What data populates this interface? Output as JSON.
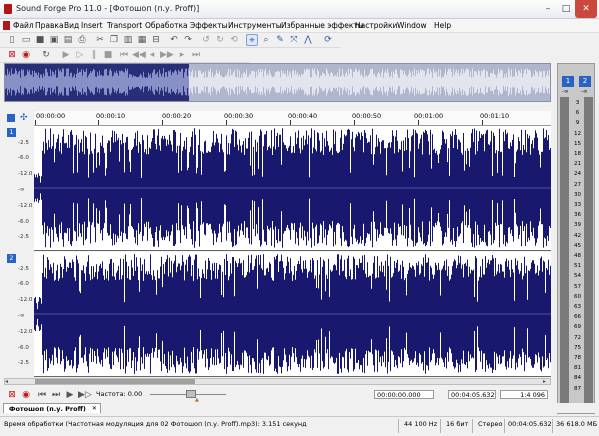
{
  "window": {
    "title": "Sound Forge Pro 11.0 - [Фотошоп (п.у. Proff)]",
    "min": "–",
    "max": "□",
    "close": "✕"
  },
  "menu": [
    "Файл",
    "Правка",
    "Вид",
    "Insert",
    "Transport",
    "Обработка",
    "Эффекты",
    "Инструменты",
    "Избранные эффекты",
    "Настройки",
    "Window",
    "Help"
  ],
  "ruler": {
    "ticks": [
      "00:00:00",
      "00:00:10",
      "00:00:20",
      "00:00:30",
      "00:00:40",
      "00:00:50",
      "00:01:00",
      "00:01:10"
    ]
  },
  "tracks": [
    {
      "number": "1",
      "db_labels": [
        "-2.5",
        "-6.0",
        "-12.0",
        "-∞",
        "-12.0",
        "-6.0",
        "-2.5"
      ]
    },
    {
      "number": "2",
      "db_labels": [
        "-2.5",
        "-6.0",
        "-12.0",
        "-∞",
        "-12.0",
        "-6.0",
        "-2.5"
      ]
    }
  ],
  "vu": {
    "buttons": [
      "1",
      "2"
    ],
    "peaks": [
      "-∞",
      "-∞"
    ],
    "scale": [
      "3",
      "6",
      "9",
      "12",
      "15",
      "18",
      "21",
      "24",
      "27",
      "30",
      "33",
      "36",
      "39",
      "42",
      "45",
      "48",
      "51",
      "54",
      "57",
      "60",
      "63",
      "66",
      "69",
      "72",
      "75",
      "78",
      "81",
      "84",
      "87"
    ],
    "bottom": [
      "-∞",
      "-∞"
    ]
  },
  "transport": {
    "rate_label": "Частота: 0.00",
    "position": "00:00:00.000",
    "length": "00:04:05.632",
    "zoom": "1:4 096"
  },
  "tab": {
    "label": "Фотошоп (п.у. Proff)",
    "close": "✕"
  },
  "status": {
    "message": "Время обработки (Частотная модуляция для 02 Фотошоп (п.у. Proff).mp3): 3.151 секунд",
    "rate": "44 100 Hz",
    "bits": "16 бит",
    "channels": "Стерео",
    "length": "00:04:05.632",
    "disk": "36 618.0 MБ"
  },
  "colors": {
    "waveform": "#18186e",
    "accent": "#2a62c4",
    "close": "#c94a3c"
  },
  "icons": {
    "toolbar1": [
      "new-icon",
      "open-icon",
      "save-icon",
      "save-as-icon",
      "render-icon",
      "print-icon",
      "cut-icon",
      "copy-icon",
      "paste-icon",
      "mix-icon",
      "trim-icon",
      "undo-icon",
      "redo-icon",
      "repeat-icon",
      "edit-tool-icon",
      "magnify-tool-icon",
      "pencil-tool-icon",
      "event-tool-icon",
      "envelope-tool-icon",
      "refresh-icon"
    ],
    "toolbar2": [
      "stop-all-icon",
      "record-icon",
      "loop-icon",
      "play-all-icon",
      "play-icon",
      "pause-icon",
      "stop-icon",
      "go-start-icon",
      "rewind-icon",
      "forward-icon",
      "go-end-icon"
    ]
  }
}
